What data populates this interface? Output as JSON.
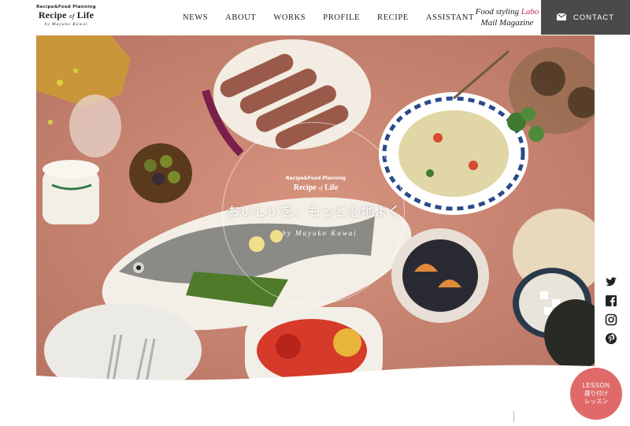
{
  "logo": {
    "sub": "Recipe&Food Planning",
    "main_a": "Recipe",
    "main_of": "of",
    "main_b": "Life",
    "sign": "by Mayuko Kawai"
  },
  "nav": [
    "NEWS",
    "ABOUT",
    "WORKS",
    "PROFILE",
    "RECIPE",
    "ASSISTANT"
  ],
  "mail": {
    "line1_a": "Food styling",
    "line1_b": "Labo",
    "line2": "Mail Magazine"
  },
  "contact": {
    "label": "CONTACT",
    "icon": "envelope-icon"
  },
  "hero": {
    "sub": "Recipe&Food Planning",
    "logo_a": "Recipe",
    "logo_of": "of",
    "logo_b": "Life",
    "tagline": "おいしいを、もっと心地よく",
    "sign": "by Mayuko Kawai"
  },
  "social": [
    "twitter-icon",
    "facebook-icon",
    "instagram-icon",
    "pinterest-icon"
  ],
  "lesson": {
    "line1": "LESSON",
    "line2": "盛り付け",
    "line3": "レッスン"
  },
  "colors": {
    "accent": "#c42e55",
    "contact_bg": "#4a4a4a",
    "lesson_bg": "#e06a6a",
    "hero_bg": "#c98876"
  }
}
